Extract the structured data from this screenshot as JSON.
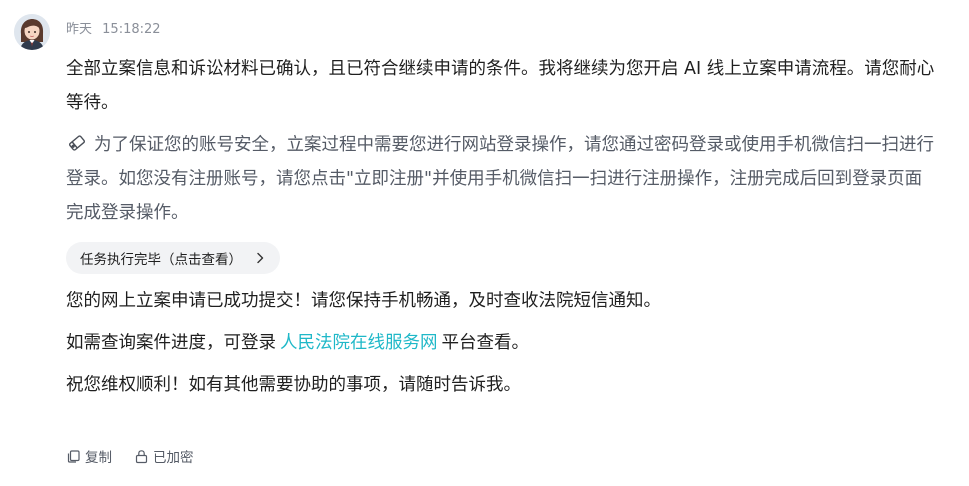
{
  "message": {
    "time_day": "昨天",
    "time_clock": "15:18:22",
    "paragraph_1": "全部立案信息和诉讼材料已确认，且已符合继续申请的条件。我将继续为您开启 AI 线上立案申请流程。请您耐心等待。",
    "note_text": "为了保证您的账号安全，立案过程中需要您进行网站登录操作，请您通过密码登录或使用手机微信扫一扫进行登录。如您没有注册账号，请您点击\"立即注册\"并使用手机微信扫一扫进行注册操作，注册完成后回到登录页面完成登录操作。",
    "task_chip_label": "任务执行完毕（点击查看）",
    "paragraph_2": "您的网上立案申请已成功提交！请您保持手机畅通，及时查收法院短信通知。",
    "paragraph_3_before": "如需查询案件进度，可登录",
    "paragraph_3_link": "人民法院在线服务网",
    "paragraph_3_after": "平台查看。",
    "paragraph_4": "祝您维权顺利！如有其他需要协助的事项，请随时告诉我。"
  },
  "actions": {
    "copy_label": "复制",
    "encrypted_label": "已加密"
  },
  "colors": {
    "link": "#1fb8c8",
    "chip_bg": "#f2f3f5",
    "meta": "#8a8f99"
  },
  "icons": {
    "avatar": "assistant-avatar",
    "note": "tag-icon",
    "chip": "chevron-right-icon",
    "copy": "copy-icon",
    "lock": "lock-icon"
  }
}
